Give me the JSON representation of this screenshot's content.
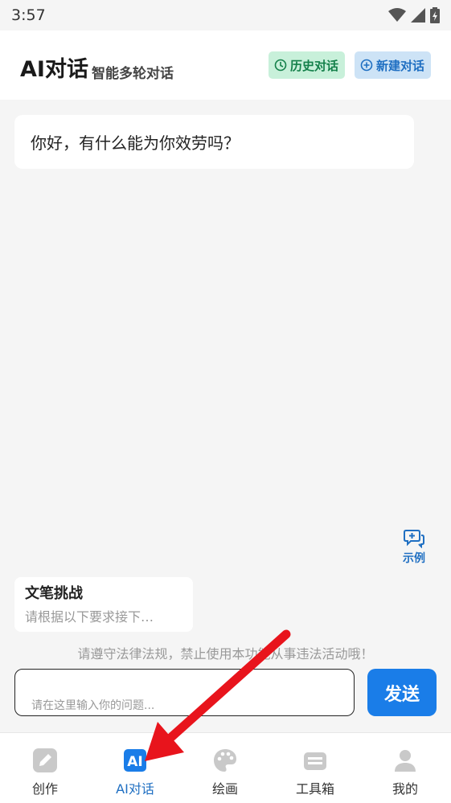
{
  "status_bar": {
    "time": "3:57"
  },
  "header": {
    "title": "AI对话",
    "subtitle": "智能多轮对话",
    "history_button": "历史对话",
    "new_chat_button": "新建对话"
  },
  "chat": {
    "greeting": "你好，有什么能为你效劳吗？"
  },
  "example": {
    "label": "示例"
  },
  "suggestion_card": {
    "title": "文笔挑战",
    "description": "请根据以下要求接下…"
  },
  "notice": "请遵守法律法规，禁止使用本功能从事违法活动哦！",
  "input": {
    "placeholder": "请在这里输入你的问题..."
  },
  "send_button": "发送",
  "bottom_nav": {
    "items": [
      {
        "label": "创作",
        "icon": "pencil-icon"
      },
      {
        "label": "AI对话",
        "icon": "ai-icon",
        "active": true
      },
      {
        "label": "绘画",
        "icon": "palette-icon"
      },
      {
        "label": "工具箱",
        "icon": "toolbox-icon"
      },
      {
        "label": "我的",
        "icon": "profile-icon"
      }
    ]
  },
  "colors": {
    "accent": "#1a7de8",
    "history_bg": "#c8f0da",
    "history_fg": "#14804a",
    "newchat_bg": "#cde3f6",
    "annotation_arrow": "#e8141c"
  }
}
